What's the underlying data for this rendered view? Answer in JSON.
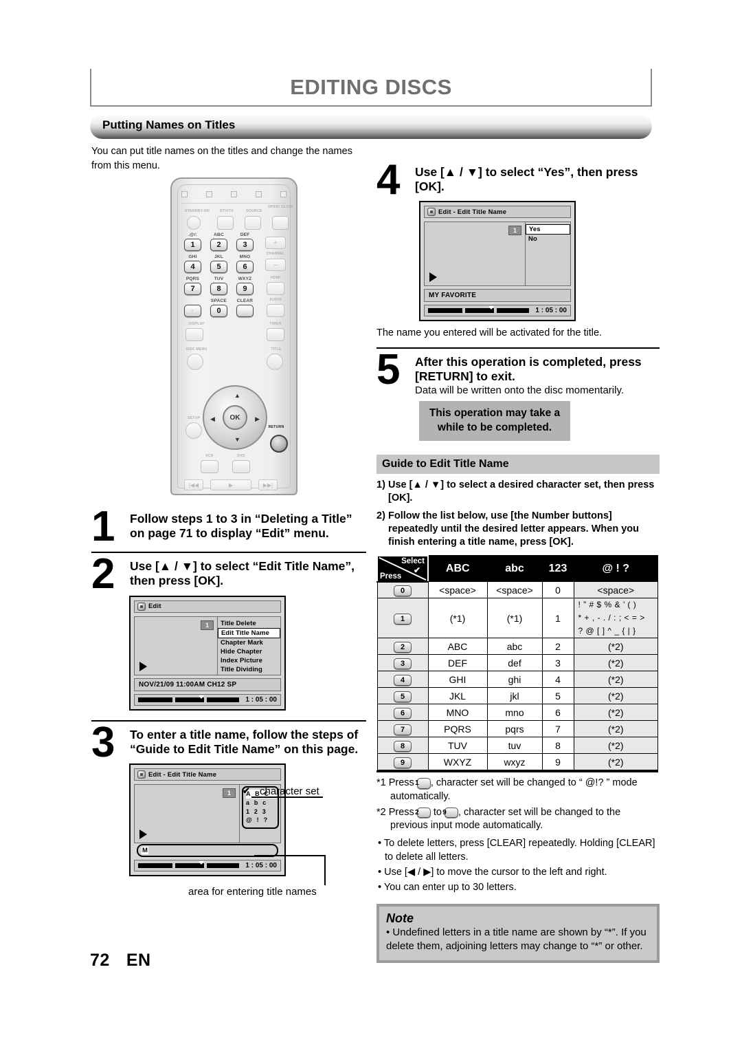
{
  "header": {
    "chapter_title": "EDITING DISCS",
    "section_title": "Putting Names on Titles",
    "intro": "You can put title names on the titles and change the names from this menu."
  },
  "footer": {
    "page_number": "72",
    "language": "EN"
  },
  "steps": {
    "one": {
      "num": "1",
      "text": "Follow steps 1 to 3 in “Deleting a Title” on page 71 to display “Edit” menu."
    },
    "two": {
      "num": "2",
      "text": "Use [▲ / ▼] to select “Edit Title Name”, then press [OK]."
    },
    "three": {
      "num": "3",
      "text": "To enter a title name, follow the steps of “Guide to Edit Title Name” on this page."
    },
    "four": {
      "num": "4",
      "text": "Use [▲ / ▼] to select “Yes”, then press [OK].",
      "caption": "The name you entered will be activated for the title."
    },
    "five": {
      "num": "5",
      "text": "After this operation is completed, press [RETURN] to exit.",
      "sub": "Data will be written onto the disc momentarily.",
      "callout": "This operation may take a while to be completed."
    }
  },
  "osd_edit_menu": {
    "title": "Edit",
    "badge": "1",
    "menu_items": [
      "Title Delete",
      "Edit Title Name",
      "Chapter Mark",
      "Hide Chapter",
      "Index Picture",
      "Title Dividing"
    ],
    "selected_item": "Edit Title Name",
    "info": "NOV/21/09 11:00AM CH12 SP",
    "time": "1 : 05 : 00"
  },
  "osd_edit_title_name": {
    "title": "Edit - Edit Title Name",
    "badge": "1",
    "charset_rows": [
      "A B C",
      "a b c",
      "1 2 3",
      "@ ! ?"
    ],
    "selected_charset": "A B C",
    "entry_text": "M",
    "time": "1 : 05 : 00",
    "callout_charset": "character set",
    "callout_entry": "area for entering title names"
  },
  "osd_yes_no": {
    "title": "Edit - Edit Title Name",
    "badge": "1",
    "options": [
      "Yes",
      "No"
    ],
    "selected_option": "Yes",
    "info": "MY FAVORITE",
    "time": "1 : 05 : 00"
  },
  "guide": {
    "heading": "Guide to Edit Title Name",
    "items": [
      {
        "num": "1)",
        "text": "Use [▲ / ▼] to select a desired character set, then press [OK]."
      },
      {
        "num": "2)",
        "text": "Follow the list below, use [the Number buttons] repeatedly until the desired letter appears. When you finish entering a title name, press [OK]."
      }
    ]
  },
  "charmap": {
    "corner": {
      "select": "Select",
      "check": "✔",
      "press": "Press"
    },
    "columns": [
      "ABC",
      "abc",
      "123",
      "@ ! ?"
    ],
    "rows": [
      {
        "key": "0",
        "abc": "<space>",
        "lower": "<space>",
        "num": "0",
        "sym": "<space>"
      },
      {
        "key": "1",
        "abc": "(*1)",
        "lower": "(*1)",
        "num": "1",
        "sym_lines": [
          "! ” # $ % & ’ ( )",
          "* + , - . / : ; < = >",
          "? @ [ ] ^ _ { | }"
        ]
      },
      {
        "key": "2",
        "abc": "ABC",
        "lower": "abc",
        "num": "2",
        "sym": "(*2)"
      },
      {
        "key": "3",
        "abc": "DEF",
        "lower": "def",
        "num": "3",
        "sym": "(*2)"
      },
      {
        "key": "4",
        "abc": "GHI",
        "lower": "ghi",
        "num": "4",
        "sym": "(*2)"
      },
      {
        "key": "5",
        "abc": "JKL",
        "lower": "jkl",
        "num": "5",
        "sym": "(*2)"
      },
      {
        "key": "6",
        "abc": "MNO",
        "lower": "mno",
        "num": "6",
        "sym": "(*2)"
      },
      {
        "key": "7",
        "abc": "PQRS",
        "lower": "pqrs",
        "num": "7",
        "sym": "(*2)"
      },
      {
        "key": "8",
        "abc": "TUV",
        "lower": "tuv",
        "num": "8",
        "sym": "(*2)"
      },
      {
        "key": "9",
        "abc": "WXYZ",
        "lower": "wxyz",
        "num": "9",
        "sym": "(*2)"
      }
    ]
  },
  "footnotes": {
    "fn1_a": "*1 Press",
    "fn1_key": "1",
    "fn1_b": ", character set will be changed to “ @!? ” mode automatically.",
    "fn2_a": "*2 Press",
    "fn2_key1": "2",
    "fn2_mid": "to",
    "fn2_key2": "9",
    "fn2_b": ", character set will be changed to the previous input mode automatically.",
    "bullets": [
      "To delete letters, press [CLEAR] repeatedly. Holding [CLEAR] to delete all letters.",
      "Use [◀ / ▶] to move the cursor to the left and right.",
      "You can enter up to 30 letters."
    ]
  },
  "note": {
    "title": "Note",
    "text": "• Undefined letters in a title name are shown by “*”. If you delete them, adjoining letters may change to “*” or other."
  },
  "remote": {
    "top_labels": [
      "STANDBY-ON",
      "DTV/TV",
      "SOURCE",
      "OPEN/ CLOSE"
    ],
    "number_keys": [
      {
        "key": "1",
        "label": ".@/:"
      },
      {
        "key": "2",
        "label": "ABC"
      },
      {
        "key": "3",
        "label": "DEF"
      },
      {
        "key": "4",
        "label": "GHI"
      },
      {
        "key": "5",
        "label": "JKL"
      },
      {
        "key": "6",
        "label": "MNO"
      },
      {
        "key": "7",
        "label": "PQRS"
      },
      {
        "key": "8",
        "label": "TUV"
      },
      {
        "key": "9",
        "label": "WXYZ"
      },
      {
        "key": "0",
        "label": "SPACE"
      }
    ],
    "clear_label": "CLEAR",
    "channel_label": "CHANNEL",
    "hdmi_label": "HDMI",
    "audio_label": "AUDIO",
    "display_label": "DISPLAY",
    "timer_label": "TIMER",
    "disc_menu_label": "DISC MENU",
    "title_label": "TITLE",
    "setup_label": "SETUP",
    "return_label": "RETURN",
    "vcr_label": "VCR",
    "dvd_label": "DVD",
    "ok_label": "OK"
  }
}
